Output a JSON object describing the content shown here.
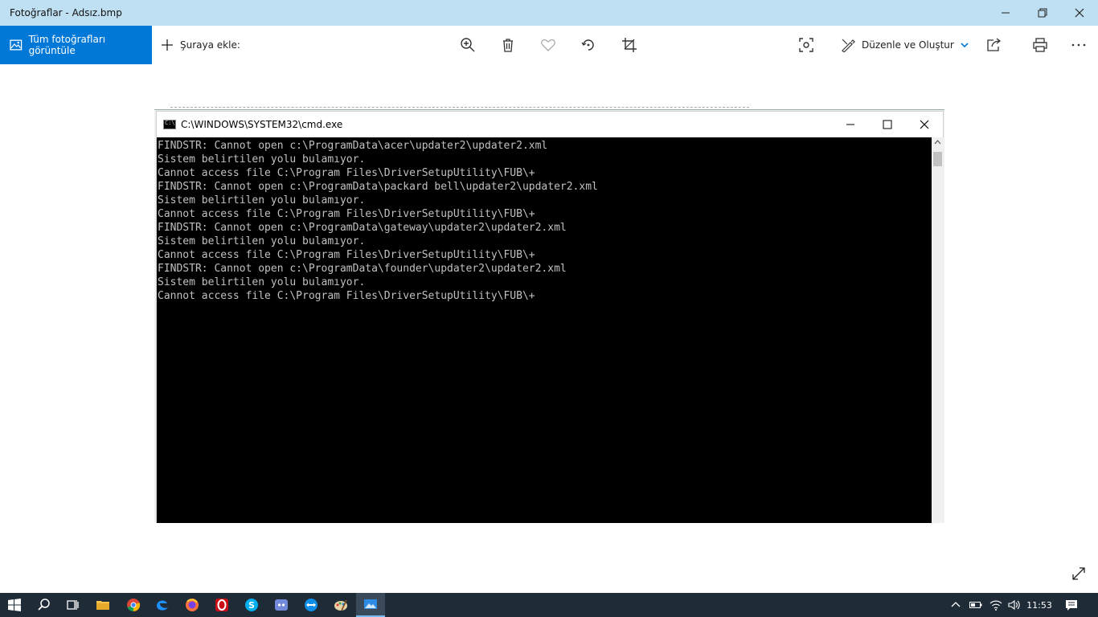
{
  "window": {
    "title": "Fotoğraflar - Adsız.bmp"
  },
  "toolbar": {
    "view_all_label": "Tüm fotoğrafları görüntüle",
    "add_to_label": "Şuraya ekle:",
    "edit_create_label": "Düzenle ve Oluştur"
  },
  "cmd": {
    "title": "C:\\WINDOWS\\SYSTEM32\\cmd.exe",
    "lines": [
      "FINDSTR: Cannot open c:\\ProgramData\\acer\\updater2\\updater2.xml",
      "Sistem belirtilen yolu bulamıyor.",
      "Cannot access file C:\\Program Files\\DriverSetupUtility\\FUB\\+",
      "FINDSTR: Cannot open c:\\ProgramData\\packard bell\\updater2\\updater2.xml",
      "Sistem belirtilen yolu bulamıyor.",
      "Cannot access file C:\\Program Files\\DriverSetupUtility\\FUB\\+",
      "FINDSTR: Cannot open c:\\ProgramData\\gateway\\updater2\\updater2.xml",
      "Sistem belirtilen yolu bulamıyor.",
      "Cannot access file C:\\Program Files\\DriverSetupUtility\\FUB\\+",
      "FINDSTR: Cannot open c:\\ProgramData\\founder\\updater2\\updater2.xml",
      "Sistem belirtilen yolu bulamıyor.",
      "Cannot access file C:\\Program Files\\DriverSetupUtility\\FUB\\+"
    ]
  },
  "taskbar": {
    "clock": "11:53",
    "apps": [
      "start-icon",
      "search-icon",
      "task-view-icon",
      "file-explorer-icon",
      "chrome-icon",
      "edge-icon",
      "firefox-icon",
      "opera-icon",
      "skype-icon",
      "discord-icon",
      "teamviewer-icon",
      "paint-icon",
      "photos-icon"
    ]
  },
  "colors": {
    "accent": "#0078d7",
    "titlebar": "#bfe0f2",
    "taskbar": "#1f2b36",
    "console_bg": "#000000",
    "console_fg": "#c0c0c0"
  }
}
